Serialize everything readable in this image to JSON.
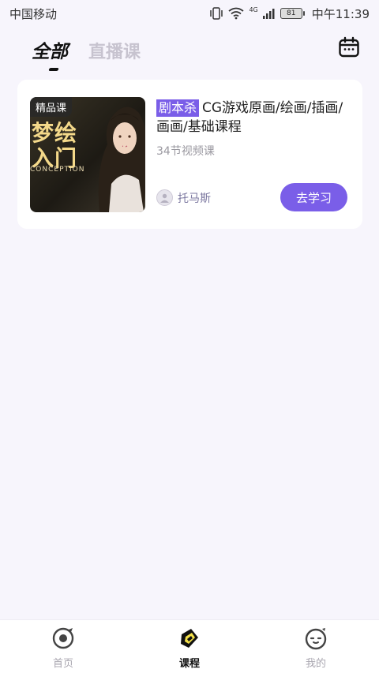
{
  "status_bar": {
    "carrier": "中国移动",
    "network": "4G",
    "battery": "81",
    "time": "中午11:39"
  },
  "tabs": [
    {
      "label": "全部",
      "active": true
    },
    {
      "label": "直播课",
      "active": false
    }
  ],
  "course": {
    "badge": "精品课",
    "thumb_title_line1": "梦绘",
    "thumb_title_line2": "入门",
    "thumb_subtitle": "CONCEPTION",
    "tag": "剧本杀",
    "title": "CG游戏原画/绘画/插画/画画/基础课程",
    "lessons": "34节视频课",
    "teacher": "托马斯",
    "action_label": "去学习"
  },
  "bottom_nav": [
    {
      "label": "首页",
      "icon": "home-icon",
      "active": false
    },
    {
      "label": "课程",
      "icon": "course-icon",
      "active": true
    },
    {
      "label": "我的",
      "icon": "profile-icon",
      "active": false
    }
  ],
  "colors": {
    "accent": "#7a5ee8",
    "background": "#f7f5fc"
  }
}
